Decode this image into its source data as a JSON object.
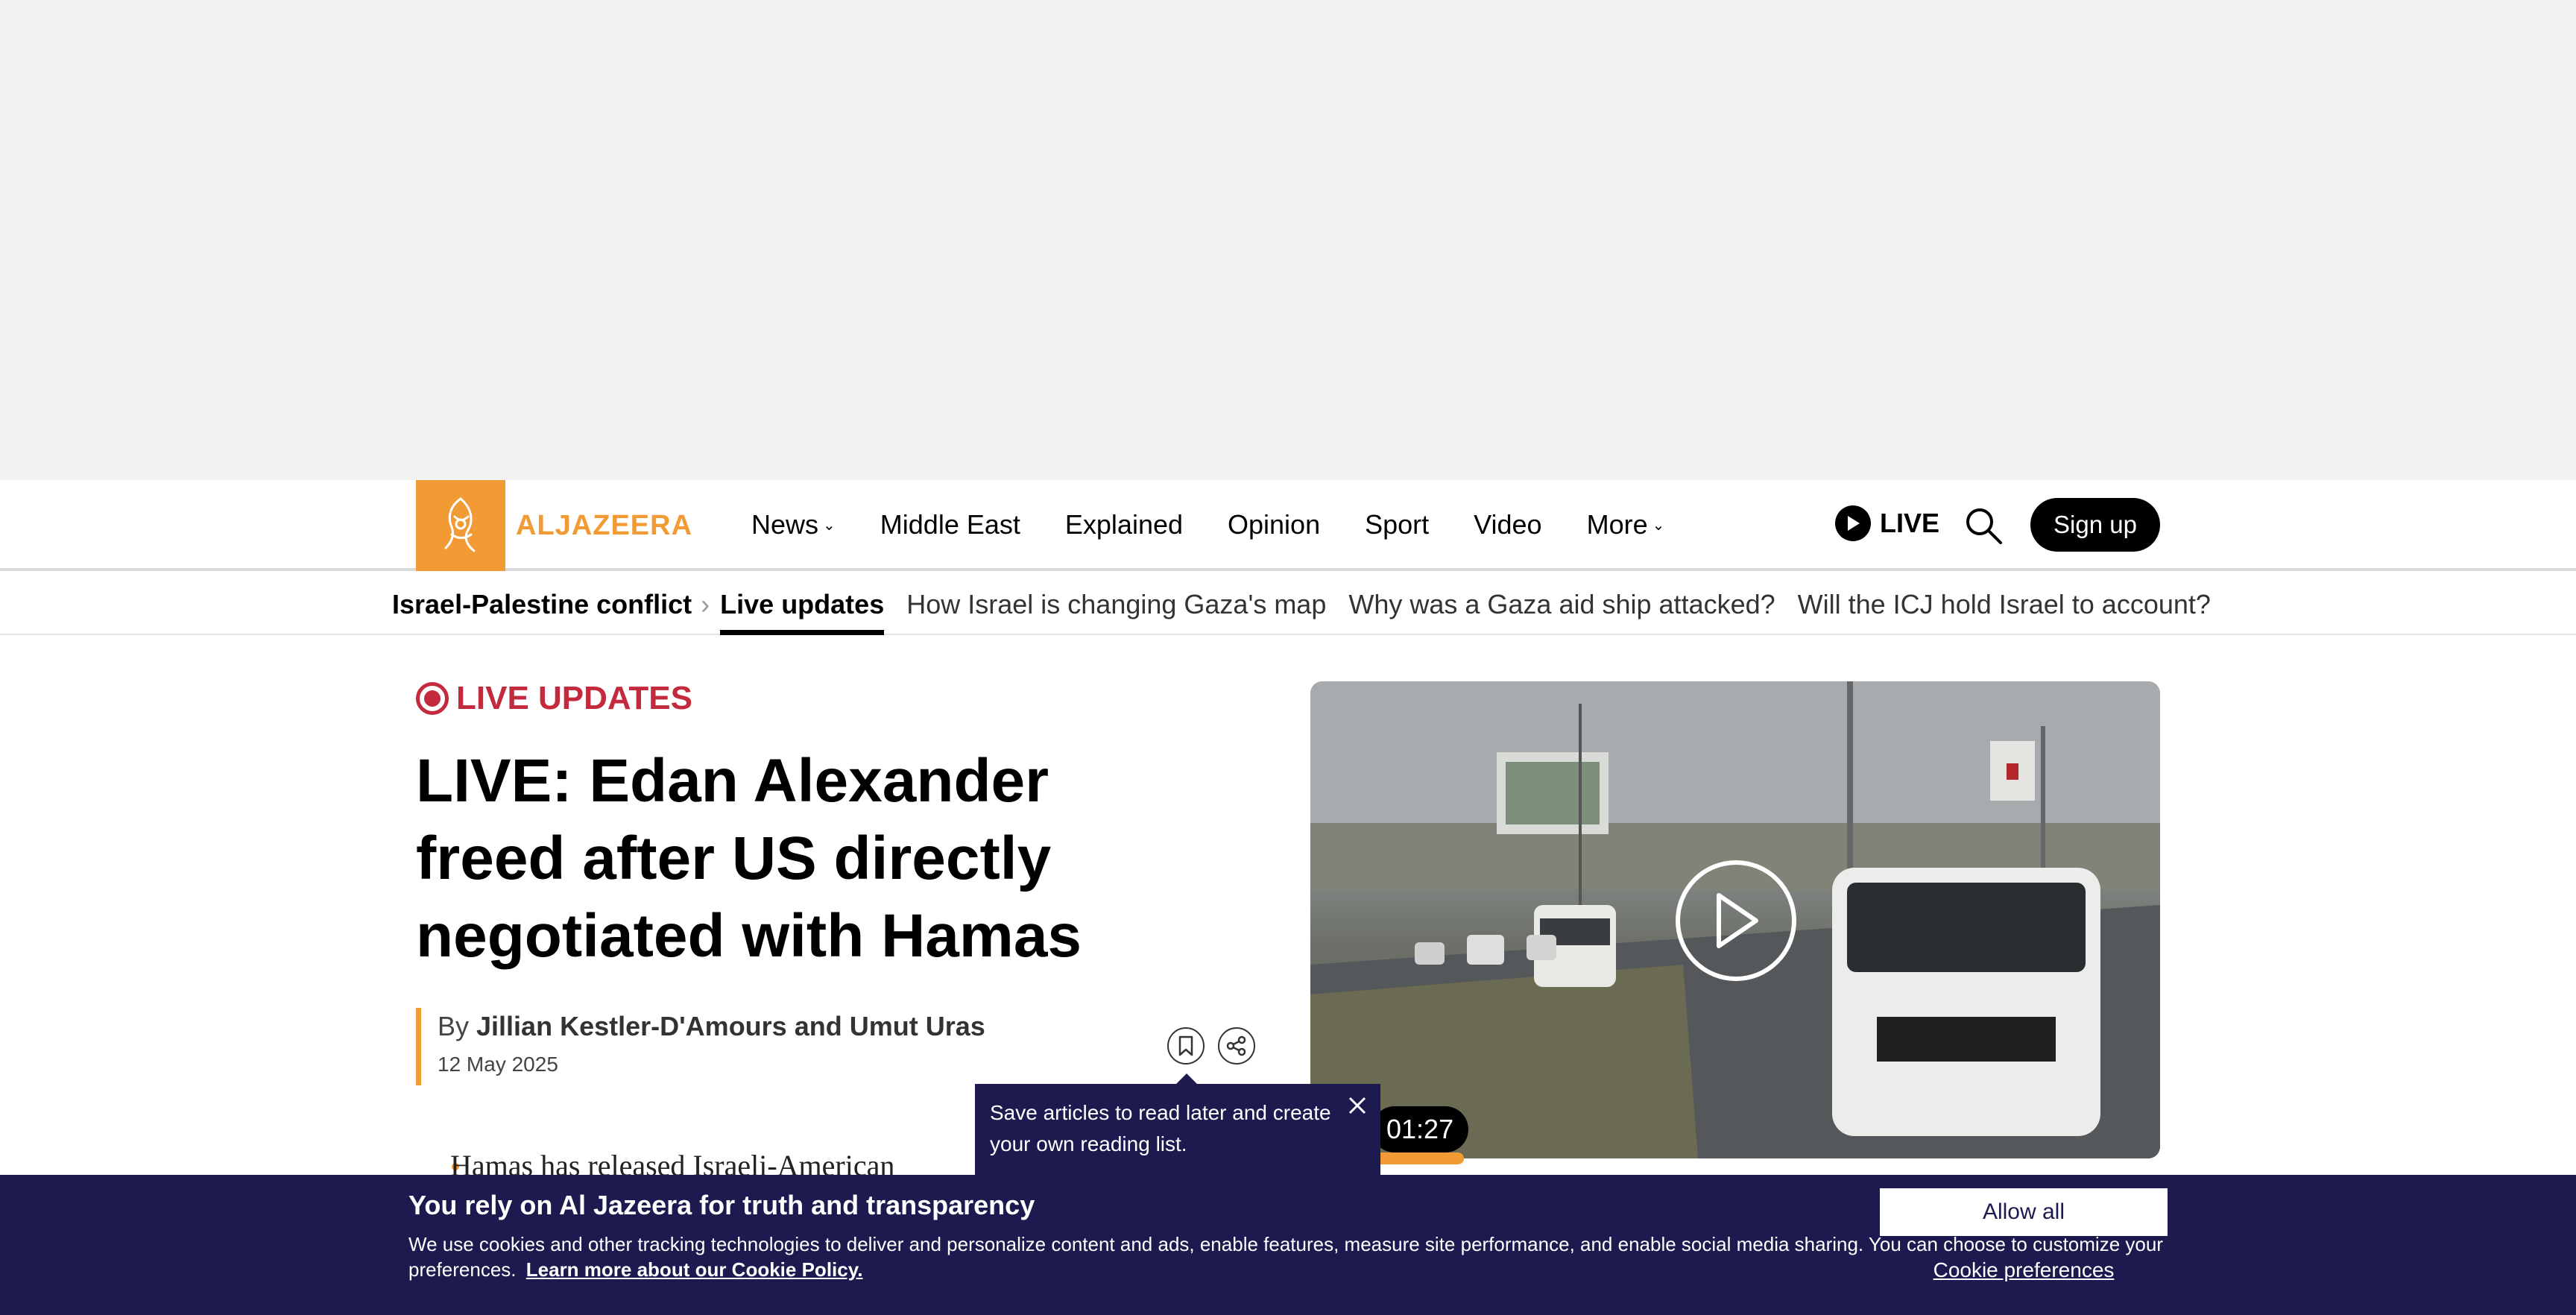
{
  "navbar": {
    "logo_text": "ALJAZEERA",
    "items": [
      {
        "label": "News",
        "has_dropdown": true
      },
      {
        "label": "Middle East",
        "has_dropdown": false
      },
      {
        "label": "Explained",
        "has_dropdown": false
      },
      {
        "label": "Opinion",
        "has_dropdown": false
      },
      {
        "label": "Sport",
        "has_dropdown": false
      },
      {
        "label": "Video",
        "has_dropdown": false
      },
      {
        "label": "More",
        "has_dropdown": true
      }
    ],
    "live_label": "LIVE",
    "signup_label": "Sign up"
  },
  "subnav": {
    "topic": "Israel-Palestine conflict",
    "items": [
      {
        "label": "Live updates",
        "active": true
      },
      {
        "label": "How Israel is changing Gaza's map",
        "active": false
      },
      {
        "label": "Why was a Gaza aid ship attacked?",
        "active": false
      },
      {
        "label": "Will the ICJ hold Israel to account?",
        "active": false
      }
    ]
  },
  "article": {
    "live_label": "LIVE UPDATES",
    "headline": "LIVE: Edan Alexander freed after US directly negotiated with Hamas",
    "byline_prefix": "By",
    "authors": "Jillian Kestler-D'Amours and Umut Uras",
    "date": "12 May 2025",
    "first_bullet": "Hamas has released Israeli-American"
  },
  "video": {
    "duration": "01:27"
  },
  "tooltip": {
    "text": "Save articles to read later and create your own reading list."
  },
  "cookie": {
    "title": "You rely on Al Jazeera for truth and transparency",
    "text": "We use cookies and other tracking technologies to deliver and personalize content and ads, enable features, measure site performance, and enable social media sharing. You can choose to customize your preferences.",
    "link": "Learn more about our Cookie Policy.",
    "allow_label": "Allow all",
    "prefs_label": "Cookie preferences"
  },
  "colors": {
    "brand": "#f29a33",
    "live_red": "#c32a3d",
    "banner_navy": "#1d1a4f"
  }
}
